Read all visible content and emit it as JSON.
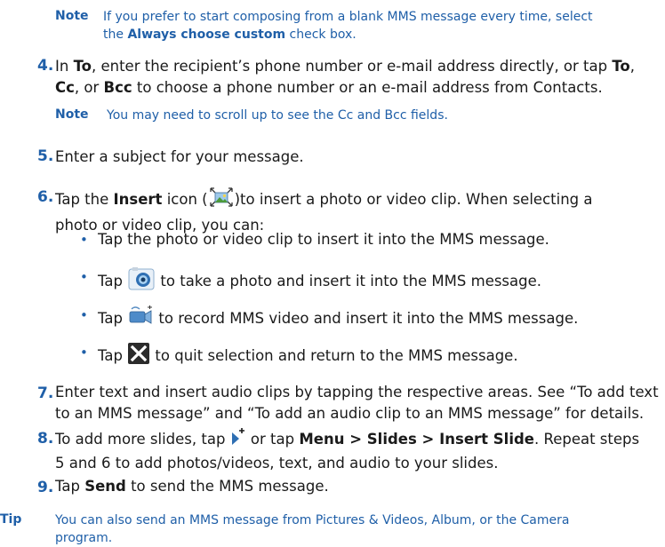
{
  "note1": {
    "label": "Note",
    "line1": "If you prefer to start composing from a blank MMS message every time, select",
    "pre": "the ",
    "bold": "Always choose custom",
    "post": " check box."
  },
  "step4": {
    "num": "4.",
    "t1": "In ",
    "b1": "To",
    "t2": ", enter the recipient’s phone number or e-mail address directly, or tap ",
    "b2": "To",
    "t3": ",",
    "b3": "Cc",
    "t4": ", or ",
    "b4": "Bcc",
    "t5": " to choose a phone number or an e-mail address from Contacts."
  },
  "note2": {
    "label": "Note",
    "text": "You may need to scroll up to see the Cc and Bcc fields."
  },
  "step5": {
    "num": "5.",
    "text": "Enter a subject for your message."
  },
  "step6": {
    "num": "6.",
    "t1": "Tap the ",
    "b1": "Insert",
    "t2": " icon (",
    "t3": ")to insert a photo or video clip. When selecting a",
    "line2": "photo or video clip, you can:"
  },
  "bullets": [
    {
      "dot": "•",
      "text": "Tap the photo or video clip to insert it into the MMS message."
    },
    {
      "dot": "•",
      "pre": "Tap ",
      "post": " to take a photo and insert it into the MMS message.",
      "icon": "camera-icon"
    },
    {
      "dot": "•",
      "pre": "Tap ",
      "post": " to record MMS video and insert it into the MMS message.",
      "icon": "video-camera-icon"
    },
    {
      "dot": "•",
      "pre": "Tap ",
      "post": " to quit selection and return to the MMS message.",
      "icon": "close-icon"
    }
  ],
  "step7": {
    "num": "7.",
    "line1": "Enter text and insert audio clips by tapping the respective areas. See “To add text",
    "line2": "to an MMS message” and “To add an audio clip to an MMS message” for details."
  },
  "step8": {
    "num": "8.",
    "t1": "To add more slides, tap ",
    "t2": " or tap ",
    "b1": "Menu > Slides > Insert Slide",
    "t3": ". Repeat steps",
    "line2": "5 and 6 to add photos/videos, text, and audio to your slides."
  },
  "step9": {
    "num": "9.",
    "t1": "Tap ",
    "b1": "Send",
    "t2": " to send the MMS message."
  },
  "tip": {
    "label": "Tip",
    "line1": "You can also send an MMS message from Pictures & Videos, Album, or the Camera",
    "line2": "program."
  },
  "colors": {
    "accent": "#1f5fa8",
    "text": "#1a1a1a"
  }
}
